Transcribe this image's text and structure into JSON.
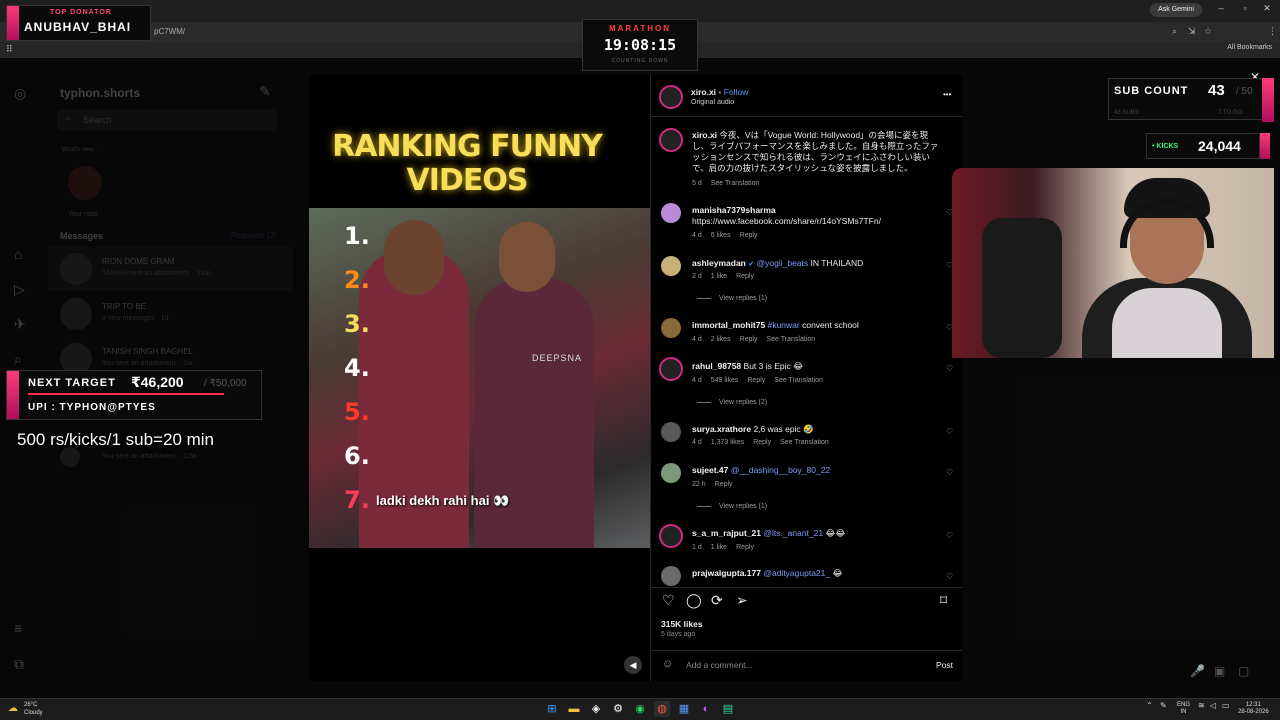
{
  "browser": {
    "url_fragment": "pC7WM/",
    "ask_gemini": "Ask Gemini",
    "all_bookmarks": "All Bookmarks"
  },
  "sidebar": {
    "username": "typhon.shorts",
    "search_placeholder": "Search",
    "note_prompt": "What's new...",
    "note_label": "Your note",
    "messages_title": "Messages",
    "requests": "Requests (3)",
    "threads": [
      {
        "name": "IRON DOME GRAM",
        "preview": "TANISH sent an attachment. · 13m"
      },
      {
        "name": "TRIP TO BE",
        "preview": "3 new messages · 1d"
      },
      {
        "name": "TANISH SINGH BAGHEL",
        "preview": "You sent an attachment. · 1w"
      },
      {
        "name": "",
        "preview": "You sent an attachment. · 12w"
      }
    ]
  },
  "video": {
    "title": "RANKING FUNNY VIDEOS",
    "rank_numbers": [
      "1.",
      "2.",
      "3.",
      "4.",
      "5.",
      "6.",
      "7."
    ],
    "caption": "ladki dekh rahi hai 👀",
    "watermark": "DEEPSNA"
  },
  "post": {
    "author": "xiro.xi",
    "follow": "Follow",
    "audio": "Original audio",
    "more": "•••",
    "caption_text": "今夜、Vは「Vogue World: Hollywood」の会場に姿を現し、ライブパフォーマンスを楽しみました。自身も際立ったファッションセンスで知られる彼は、ランウェイにふさわしい装いで、肩の力の抜けたスタイリッシュな姿を披露しました。",
    "caption_time": "5 d",
    "see_translation": "See Translation",
    "likes": "315K likes",
    "posted": "5 days ago",
    "add_comment_placeholder": "Add a comment...",
    "post_button": "Post",
    "comments": [
      {
        "user": "manisha7379sharma",
        "mention": "",
        "text": "https://www.facebook.com/share/r/14oYSMs7TFn/",
        "time": "4 d",
        "likes": "6 likes",
        "reply": "Reply",
        "translate": ""
      },
      {
        "user": "ashleymadan",
        "mention": "@yogii_beats",
        "text": " IN THAILAND",
        "time": "2 d",
        "likes": "1 like",
        "reply": "Reply",
        "translate": "",
        "replies": "View replies (1)"
      },
      {
        "user": "immortal_mohit75",
        "mention": "#kunwar",
        "text": " convent school",
        "time": "4 d",
        "likes": "2 likes",
        "reply": "Reply",
        "translate": "See Translation"
      },
      {
        "user": "rahul_98758",
        "mention": "",
        "text": "But 3 is Epic 😂",
        "time": "4 d",
        "likes": "549 likes",
        "reply": "Reply",
        "translate": "See Translation",
        "replies": "View replies (2)"
      },
      {
        "user": "surya.xrathore",
        "mention": "",
        "text": "2,6 was epic 🤣",
        "time": "4 d",
        "likes": "1,373 likes",
        "reply": "Reply",
        "translate": "See Translation"
      },
      {
        "user": "sujeet.47",
        "mention": "@__dashing__boy_80_22",
        "text": "",
        "time": "22 h",
        "likes": "",
        "reply": "Reply",
        "translate": "",
        "replies": "View replies (1)"
      },
      {
        "user": "s_a_m_rajput_21",
        "mention": "@its._anant_21",
        "text": " 😂😂",
        "time": "1 d",
        "likes": "1 like",
        "reply": "Reply",
        "translate": ""
      },
      {
        "user": "prajwalgupta.177",
        "mention": "@adityagupta21_",
        "text": " 😂",
        "time": "",
        "likes": "",
        "reply": "",
        "translate": ""
      }
    ]
  },
  "overlays": {
    "top_donator_label": "TOP DONATOR",
    "top_donator_name": "ANUBHAV_BHAI",
    "marathon_label": "MARATHON",
    "marathon_time": "19:08:15",
    "marathon_sub": "COUNTING DOWN",
    "sub_count_label": "SUB COUNT",
    "sub_count_value": "43",
    "sub_count_goal": "/ 50",
    "sub_count_subs": "43 SUBS",
    "sub_count_togo": "7 TO GO",
    "kicks_label": "• KICKS",
    "kicks_value": "24,044",
    "next_target_label": "NEXT TARGET",
    "next_target_value": "₹46,200",
    "next_target_goal": "/ ₹50,000",
    "next_target_progress": 0.924,
    "upi": "UPI : TYPHON@PTYES",
    "rate_text": "500 rs/kicks/1 sub=20 min"
  },
  "taskbar": {
    "temp": "26°C",
    "weather": "Cloudy",
    "lang": "ENG",
    "region": "IN",
    "time": "12:31",
    "date": "28-08-2026"
  },
  "colors": {
    "accent_pink": "#ff3a7a",
    "kicks_green": "#39ff7a",
    "mention_blue": "#7c9cf6",
    "title_yellow": "#f7df5a"
  }
}
